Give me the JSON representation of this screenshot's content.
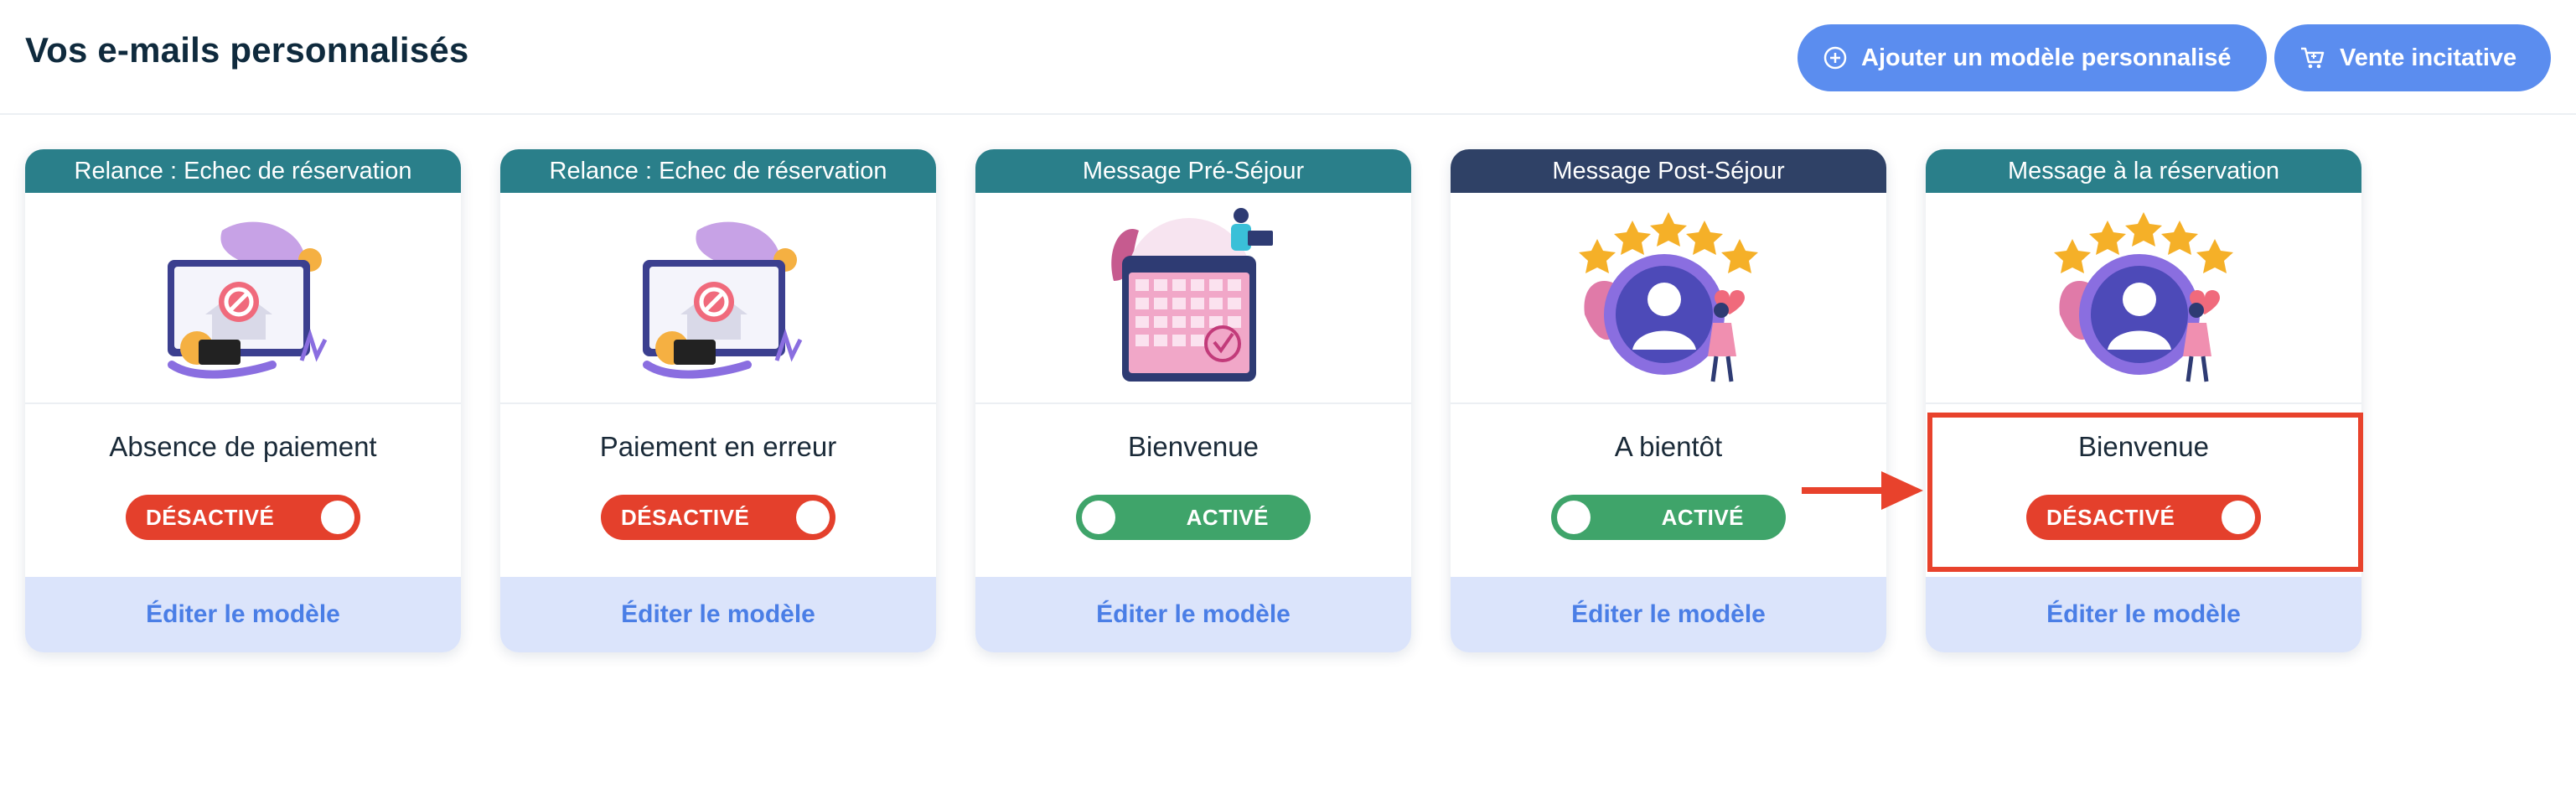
{
  "header": {
    "title": "Vos e-mails personnalisés",
    "add_button": "Ajouter un modèle personnalisé",
    "upsell_button": "Vente incitative"
  },
  "cards": [
    {
      "header": "Relance : Echec de réservation",
      "name": "Absence de paiement",
      "status": "DÉSACTIVÉ",
      "edit": "Éditer le modèle"
    },
    {
      "header": "Relance : Echec de réservation",
      "name": "Paiement en erreur",
      "status": "DÉSACTIVÉ",
      "edit": "Éditer le modèle"
    },
    {
      "header": "Message Pré-Séjour",
      "name": "Bienvenue",
      "status": "ACTIVÉ",
      "edit": "Éditer le modèle"
    },
    {
      "header": "Message Post-Séjour",
      "name": "A bientôt",
      "status": "ACTIVÉ",
      "edit": "Éditer le modèle"
    },
    {
      "header": "Message à la réservation",
      "name": "Bienvenue",
      "status": "DÉSACTIVÉ",
      "edit": "Éditer le modèle"
    }
  ],
  "colors": {
    "primary_button": "#5b8def",
    "header_teal": "#2a7f8a",
    "header_navy": "#2f4166",
    "off_toggle": "#e4402c",
    "on_toggle": "#3fa46a",
    "highlight": "#e8422c"
  },
  "icons": [
    "plus-circle-icon",
    "cart-icon",
    "payment-failed-illustration",
    "calendar-illustration",
    "review-stars-illustration",
    "arrow-right-icon"
  ]
}
